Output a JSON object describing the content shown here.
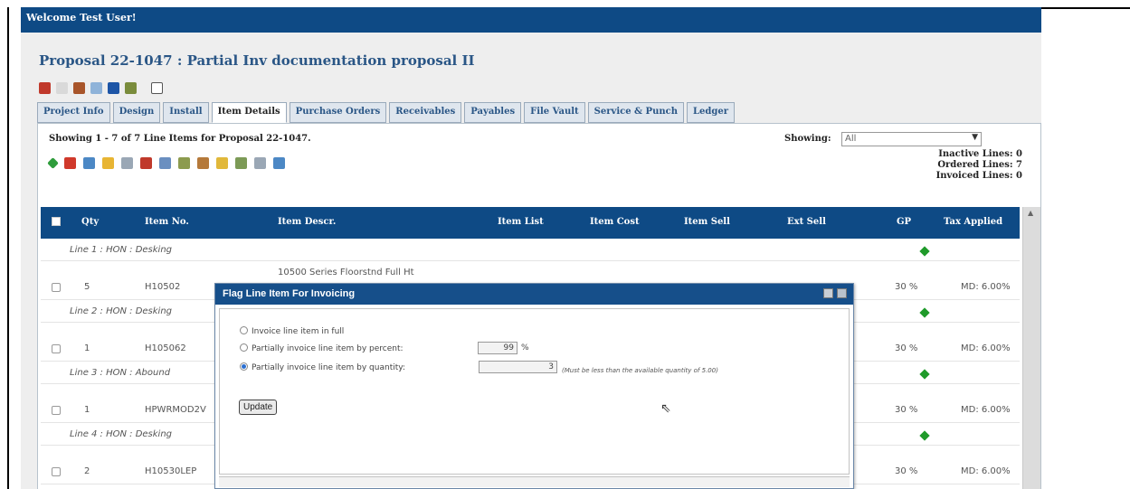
{
  "header": {
    "welcome": "Welcome Test User!"
  },
  "proposal_title": "Proposal 22-1047 : Partial Inv documentation proposal II",
  "tabs": [
    {
      "label": "Project Info"
    },
    {
      "label": "Design"
    },
    {
      "label": "Install"
    },
    {
      "label": "Item Details"
    },
    {
      "label": "Purchase Orders"
    },
    {
      "label": "Receivables"
    },
    {
      "label": "Payables"
    },
    {
      "label": "File Vault"
    },
    {
      "label": "Service & Punch"
    },
    {
      "label": "Ledger"
    }
  ],
  "active_tab": "Item Details",
  "panel": {
    "showing_text": "Showing 1 - 7 of 7 Line Items for Proposal 22-1047.",
    "showing_label": "Showing:",
    "showing_value": "All",
    "inactive_lines": "Inactive Lines: 0",
    "ordered_lines": "Ordered Lines: 7",
    "invoiced_lines": "Invoiced Lines: 0"
  },
  "columns": {
    "qty": "Qty",
    "item_no": "Item No.",
    "item_descr": "Item Descr.",
    "item_list": "Item List",
    "item_cost": "Item Cost",
    "item_sell": "Item Sell",
    "ext_sell": "Ext Sell",
    "gp": "GP",
    "tax": "Tax Applied"
  },
  "rows": [
    {
      "group": "Line 1 :  HON : Desking",
      "qty": "5",
      "item_no": "H10502",
      "descr": "10500 Series Floorstnd Full Ht",
      "gp": "30 %",
      "tax": "MD: 6.00%"
    },
    {
      "group": "Line 2 :  HON : Desking",
      "qty": "1",
      "item_no": "H105062",
      "descr": "",
      "gp": "30 %",
      "tax": "MD: 6.00%"
    },
    {
      "group": "Line 3 :  HON : Abound",
      "qty": "1",
      "item_no": "HPWRMOD2V",
      "descr": "",
      "gp": "30 %",
      "tax": "MD: 6.00%"
    },
    {
      "group": "Line 4 :  HON : Desking",
      "qty": "2",
      "item_no": "H10530LEP",
      "descr": "",
      "gp": "30 %",
      "tax": "MD: 6.00%"
    }
  ],
  "dialog": {
    "title": "Flag Line Item For Invoicing",
    "option_full": "Invoice line item in full",
    "option_percent": "Partially invoice line item by percent:",
    "percent_value": "99",
    "percent_unit": "%",
    "option_quantity": "Partially invoice line item by quantity:",
    "quantity_value": "3",
    "quantity_note": "(Must be less than the available quantity of 5.00)",
    "update_label": "Update"
  },
  "colors": {
    "brand_blue": "#0e4a85",
    "title_blue": "#2a5686",
    "gp_green": "#1f9a2a"
  }
}
